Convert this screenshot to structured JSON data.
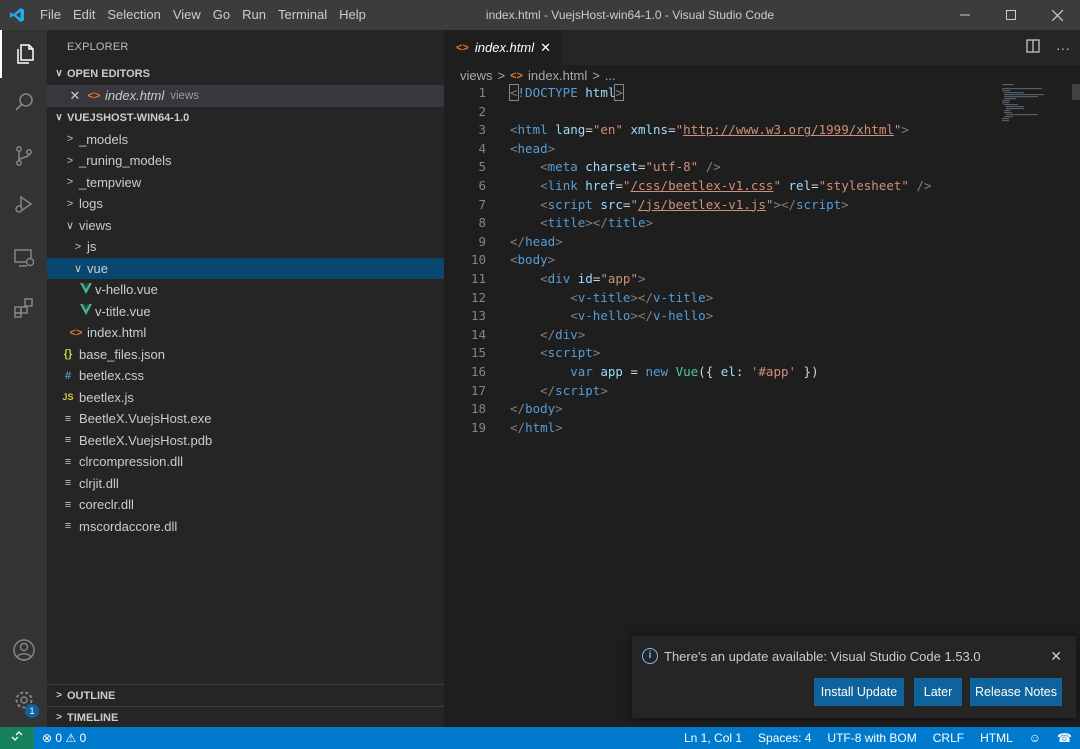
{
  "titlebar": {
    "menu": [
      "File",
      "Edit",
      "Selection",
      "View",
      "Go",
      "Run",
      "Terminal",
      "Help"
    ],
    "title": "index.html - VuejsHost-win64-1.0 - Visual Studio Code"
  },
  "colors": {
    "accent": "#007acc",
    "selection": "#094771",
    "remote": "#16825d",
    "html_icon": "#e37933",
    "vue_icon": "#41b883"
  },
  "activity": {
    "settings_badge": "1"
  },
  "sidebar": {
    "title": "EXPLORER",
    "open_editors_header": "OPEN EDITORS",
    "open_editor": {
      "name": "index.html",
      "folder": "views"
    },
    "project_header": "VUEJSHOST-WIN64-1.0",
    "tree": [
      {
        "label": "_models",
        "icon": "chevron-right"
      },
      {
        "label": "_runing_models",
        "icon": "chevron-right"
      },
      {
        "label": "_tempview",
        "icon": "chevron-right"
      },
      {
        "label": "logs",
        "icon": "chevron-right"
      },
      {
        "label": "views",
        "icon": "chevron-down"
      },
      {
        "label": "js",
        "icon": "chevron-right"
      },
      {
        "label": "vue",
        "icon": "chevron-down"
      },
      {
        "label": "v-hello.vue",
        "icon": "vue-icon"
      },
      {
        "label": "v-title.vue",
        "icon": "vue-icon"
      },
      {
        "label": "index.html",
        "icon": "html-icon"
      },
      {
        "label": "base_files.json",
        "icon": "json-icon"
      },
      {
        "label": "beetlex.css",
        "icon": "css-icon"
      },
      {
        "label": "beetlex.js",
        "icon": "js-icon"
      },
      {
        "label": "BeetleX.VuejsHost.exe",
        "icon": "file-icon"
      },
      {
        "label": "BeetleX.VuejsHost.pdb",
        "icon": "file-icon"
      },
      {
        "label": "clrcompression.dll",
        "icon": "file-icon"
      },
      {
        "label": "clrjit.dll",
        "icon": "file-icon"
      },
      {
        "label": "coreclr.dll",
        "icon": "file-icon"
      },
      {
        "label": "mscordaccore.dll",
        "icon": "file-icon"
      }
    ],
    "outline_header": "OUTLINE",
    "timeline_header": "TIMELINE"
  },
  "editor": {
    "tab_label": "index.html",
    "breadcrumb": {
      "folder": "views",
      "file": "index.html",
      "rest": "..."
    },
    "lines": [
      "1",
      "2",
      "3",
      "4",
      "5",
      "6",
      "7",
      "8",
      "9",
      "10",
      "11",
      "12",
      "13",
      "14",
      "15",
      "16",
      "17",
      "18",
      "19"
    ]
  },
  "notification": {
    "message": "There's an update available: Visual Studio Code 1.53.0",
    "install": "Install Update",
    "later": "Later",
    "notes": "Release Notes"
  },
  "statusbar": {
    "errors": "0",
    "warnings": "0",
    "position": "Ln 1, Col 1",
    "spaces": "Spaces: 4",
    "encoding": "UTF-8 with BOM",
    "eol": "CRLF",
    "language": "HTML"
  }
}
